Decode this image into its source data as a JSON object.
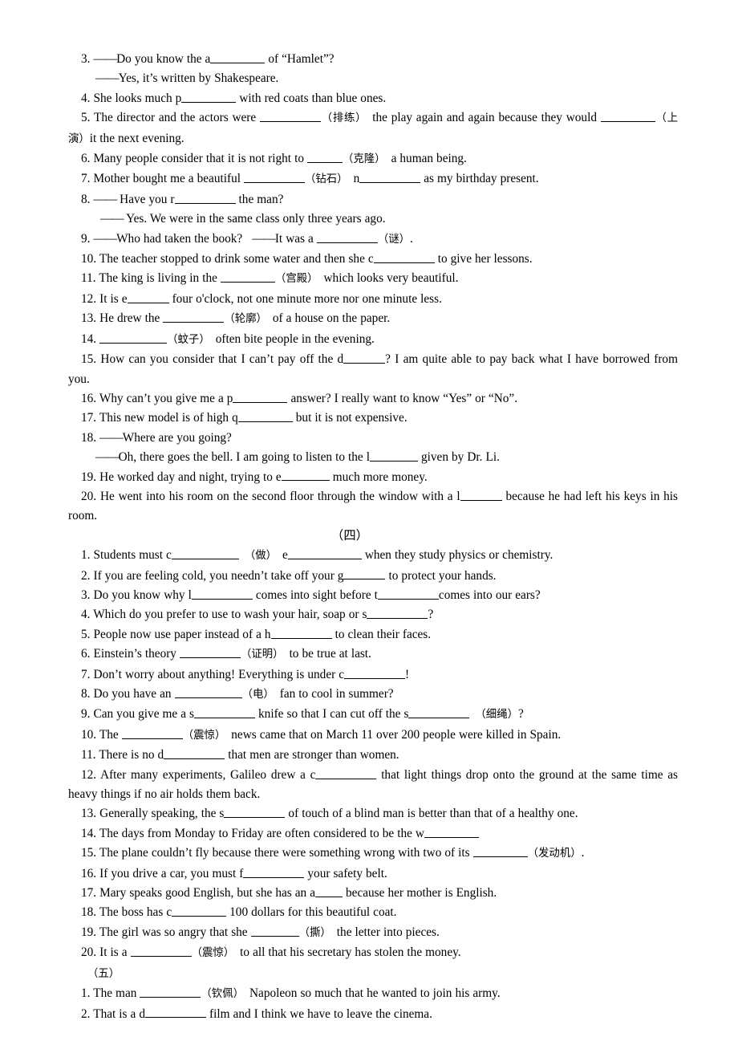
{
  "document": {
    "type": "english-vocabulary-fill-in-the-blank-worksheet",
    "sections": [
      {
        "id": "section-three-continued",
        "header": null,
        "items": [
          {
            "num": "3.",
            "text_parts": [
              "——Do you know the a",
              "BLANK_8",
              " of “Hamlet”?"
            ]
          },
          {
            "num": "",
            "text_parts": [
              "——Yes, it’s written by Shakespeare."
            ]
          },
          {
            "num": "4.",
            "text_parts": [
              "She looks much p",
              "BLANK_8",
              " with red coats than blue ones."
            ]
          },
          {
            "num": "5.",
            "text_parts": [
              "The director and the actors were ",
              "BLANK_9",
              " （排练） the play again and again because they would ",
              "BLANK_8",
              " （上演） it the next evening."
            ]
          },
          {
            "num": "6.",
            "text_parts": [
              "Many people consider that it is not right to ",
              "BLANK_5",
              " （克隆） a human being."
            ]
          },
          {
            "num": "7.",
            "text_parts": [
              "Mother bought me a beautiful ",
              "BLANK_9",
              " （钻石） n",
              "BLANK_9",
              " as my birthday present."
            ]
          },
          {
            "num": "8.",
            "text_parts": [
              "—— Have you r",
              "BLANK_9",
              " the man?"
            ]
          },
          {
            "num": "",
            "text_parts": [
              "—— Yes. We were in the same class only three years ago."
            ]
          },
          {
            "num": "9.",
            "text_parts": [
              "——Who had taken the book?  ——It was a ",
              "BLANK_9",
              " （谜）."
            ]
          },
          {
            "num": "10.",
            "text_parts": [
              "The teacher stopped to drink some water and then she c",
              "BLANK_9",
              " to give her lessons."
            ]
          },
          {
            "num": "11.",
            "text_parts": [
              "The king is living in the ",
              "BLANK_8",
              " （宫殿） which looks very beautiful."
            ]
          },
          {
            "num": "12.",
            "text_parts": [
              "It is e",
              "BLANK_6",
              " four o'clock, not one minute more nor one minute less."
            ]
          },
          {
            "num": "13.",
            "text_parts": [
              "He drew the ",
              "BLANK_9",
              " （轮廓） of a house on the paper."
            ]
          },
          {
            "num": "14.",
            "text_parts": [
              "",
              "BLANK_10",
              " （蚊子） often bite people in the evening."
            ]
          },
          {
            "num": "15.",
            "text_parts": [
              "How can you consider that I can’t pay off the d",
              "BLANK_6",
              "? I am quite able to pay back what I have borrowed from you."
            ]
          },
          {
            "num": "16.",
            "text_parts": [
              "Why can’t you give me a p",
              "BLANK_8",
              " answer? I really want to know “Yes” or “No”."
            ]
          },
          {
            "num": "17.",
            "text_parts": [
              "This new model is of high q",
              "BLANK_8",
              " but it is not expensive."
            ]
          },
          {
            "num": "18.",
            "text_parts": [
              "——Where are you going?"
            ]
          },
          {
            "num": "",
            "text_parts": [
              "——Oh, there goes the bell. I am going to listen to the l",
              "BLANK_7",
              " given by Dr. Li."
            ]
          },
          {
            "num": "19.",
            "text_parts": [
              "He worked day and night, trying to e",
              "BLANK_7",
              " much more money."
            ]
          },
          {
            "num": "20.",
            "text_parts": [
              "He went into his room on the second floor through the window with a l",
              "BLANK_6",
              " because he had left his keys in his room."
            ]
          }
        ]
      },
      {
        "id": "section-four",
        "header": "（四）",
        "items": [
          {
            "num": "1.",
            "text_parts": [
              "Students must c",
              "BLANK_10",
              " （做） e",
              "BLANK_12",
              " when they study physics or chemistry."
            ]
          },
          {
            "num": "2.",
            "text_parts": [
              "If you are feeling cold, you needn’t take off your g",
              "BLANK_6",
              " to protect your hands."
            ]
          },
          {
            "num": "3.",
            "text_parts": [
              "Do you know why l",
              "BLANK_9",
              " comes into sight before t",
              "BLANK_9",
              " comes into our ears?"
            ]
          },
          {
            "num": "4.",
            "text_parts": [
              "Which do you prefer to use to wash your hair, soap or s",
              "BLANK_9",
              "?"
            ]
          },
          {
            "num": "5.",
            "text_parts": [
              "People now use paper instead of a h",
              "BLANK_9",
              " to clean their faces."
            ]
          },
          {
            "num": "6.",
            "text_parts": [
              "Einstein’s theory ",
              "BLANK_9",
              " （证明） to be true at last."
            ]
          },
          {
            "num": "7.",
            "text_parts": [
              "Don’t worry about anything! Everything is under c",
              "BLANK_9",
              "!"
            ]
          },
          {
            "num": "8.",
            "text_parts": [
              "Do you have an ",
              "BLANK_10",
              " （电） fan to cool in summer?"
            ]
          },
          {
            "num": "9.",
            "text_parts": [
              "Can you give me a s",
              "BLANK_9",
              " knife so that I can cut off the s",
              "BLANK_9",
              " （细绳）?"
            ]
          },
          {
            "num": "10.",
            "text_parts": [
              "The ",
              "BLANK_9",
              " （震惊） news came that on March 11 over 200 people were killed in Spain."
            ]
          },
          {
            "num": "11.",
            "text_parts": [
              "There is no d",
              "BLANK_9",
              " that men are stronger than women."
            ]
          },
          {
            "num": "12.",
            "text_parts": [
              "After many experiments, Galileo drew a c",
              "BLANK_9",
              " that light things drop onto the ground at the same time as heavy things if no air holds them back."
            ]
          },
          {
            "num": "13.",
            "text_parts": [
              "Generally speaking, the s",
              "BLANK_9",
              " of touch of a blind man is better than that of a healthy one."
            ]
          },
          {
            "num": "14.",
            "text_parts": [
              "The days from Monday to Friday are often considered to be the w",
              "BLANK_8",
              ""
            ]
          },
          {
            "num": "15.",
            "text_parts": [
              "The plane couldn’t fly because there were something wrong with two of its ",
              "BLANK_8",
              " （发动机）."
            ]
          },
          {
            "num": "16.",
            "text_parts": [
              "If you drive a car, you must f",
              "BLANK_9",
              " your safety belt."
            ]
          },
          {
            "num": "17.",
            "text_parts": [
              "Mary speaks good English, but she has an a",
              "BLANK_4",
              " because her mother is English."
            ]
          },
          {
            "num": "18.",
            "text_parts": [
              "The boss has c",
              "BLANK_8",
              " 100 dollars for this beautiful coat."
            ]
          },
          {
            "num": "19.",
            "text_parts": [
              "The girl was so angry that she ",
              "BLANK_7",
              " （撕） the letter into pieces."
            ]
          },
          {
            "num": "20.",
            "text_parts": [
              "It is a ",
              "BLANK_9",
              " （震惊） to all that his secretary has stolen the money."
            ]
          }
        ]
      },
      {
        "id": "section-five",
        "header": "（五）",
        "items": [
          {
            "num": "1.",
            "text_parts": [
              "The man ",
              "BLANK_9",
              " （钦佩） Napoleon so much that he wanted to join his army."
            ]
          },
          {
            "num": "2.",
            "text_parts": [
              "That is a d",
              "BLANK_9",
              " film and I think we have to leave the cinema."
            ]
          }
        ]
      }
    ]
  },
  "lines": {
    "q3a_num": "3.",
    "q3a_dash": "——",
    "q3a_t1": "Do you know the a",
    "q3a_t2": "of “Hamlet”?",
    "q3b_dash": "——",
    "q3b_t1": "Yes, it’s written by Shakespeare.",
    "q4_num": "4.",
    "q4_t1": "She looks much p",
    "q4_t2": "with red coats than blue ones.",
    "q5_num": "5.",
    "q5_t1": "The director and the actors were",
    "q5_cn1": "（排练）",
    "q5_t2": "the play again and again because they would",
    "q5_cn2": "（上演）",
    "q5_t3": "it the next evening.",
    "q6_num": "6.",
    "q6_t1": "Many people consider that it is not right to",
    "q6_cn1": "（克隆）",
    "q6_t2": "a human being.",
    "q7_num": "7.",
    "q7_t1": "Mother bought me a beautiful",
    "q7_cn1": "（钻石）",
    "q7_t2": "n",
    "q7_t3": "as my birthday present.",
    "q8a_num": "8.",
    "q8a_dash": "——",
    "q8a_t1": "Have you r",
    "q8a_t2": "the man?",
    "q8b_dash": "——",
    "q8b_t1": "Yes. We were in the same class only three years ago.",
    "q9_num": "9.",
    "q9_dash1": "——",
    "q9_t1": "Who had taken the book?",
    "q9_dash2": "——",
    "q9_t2": "It was a",
    "q9_cn1": "（谜）",
    "q9_t3": ".",
    "q10_num": "10.",
    "q10_t1": "The teacher stopped to drink some water and then she c",
    "q10_t2": "to give her lessons.",
    "q11_num": "11.",
    "q11_t1": "The king is living in the",
    "q11_cn1": "（宫殿）",
    "q11_t2": "which looks very beautiful.",
    "q12_num": "12.",
    "q12_t1": "It is e",
    "q12_t2": "four o'clock, not one minute more nor one minute less.",
    "q13_num": "13.",
    "q13_t1": "He drew the",
    "q13_cn1": "（轮廓）",
    "q13_t2": "of a house on the paper.",
    "q14_num": "14.",
    "q14_cn1": "（蚊子）",
    "q14_t2": "often bite people in the evening.",
    "q15_num": "15.",
    "q15_t1": "How can you consider that I can’t pay off the d",
    "q15_t2": "? I am quite able to pay back what I have borrowed from you.",
    "q16_num": "16.",
    "q16_t1": "Why can’t you give me a p",
    "q16_t2": "answer? I really want to know “Yes” or “No”.",
    "q17_num": "17.",
    "q17_t1": "This new model is of high q",
    "q17_t2": "but it is not expensive.",
    "q18a_num": "18.",
    "q18a_dash": "——",
    "q18a_t1": "Where are you going?",
    "q18b_dash": "——",
    "q18b_t1": "Oh, there goes the bell. I am going to listen to the l",
    "q18b_t2": "given by Dr. Li.",
    "q19_num": "19.",
    "q19_t1": "He worked day and night, trying to e",
    "q19_t2": "much more money.",
    "q20_num": "20.",
    "q20_t1": "He went into his room on the second floor through the window with a l",
    "q20_t2": "because he had left his keys in his room.",
    "s4_header": "（四）",
    "f1_num": "1.",
    "f1_t1": "Students must c",
    "f1_cn1": "（做）",
    "f1_t2": "e",
    "f1_t3": "when they study physics or chemistry.",
    "f2_num": "2.",
    "f2_t1": "If you are feeling cold, you needn’t take off your g",
    "f2_t2": "to protect your hands.",
    "f3_num": "3.",
    "f3_t1": "Do you know why l",
    "f3_t2": "comes into sight before t",
    "f3_t3": "comes into our ears?",
    "f4_num": "4.",
    "f4_t1": "Which do you prefer to use to wash your hair, soap or s",
    "f4_t2": "?",
    "f5_num": "5.",
    "f5_t1": "People now use paper instead of a h",
    "f5_t2": "to clean their faces.",
    "f6_num": "6.",
    "f6_t1": "Einstein’s theory",
    "f6_cn1": "（证明）",
    "f6_t2": "to be true at last.",
    "f7_num": "7.",
    "f7_t1": "Don’t worry about anything! Everything is under c",
    "f7_t2": "!",
    "f8_num": "8.",
    "f8_t1": "Do you have an",
    "f8_cn1": "（电）",
    "f8_t2": "fan to cool in summer?",
    "f9_num": "9.",
    "f9_t1": "Can you give me a s",
    "f9_t2": "knife so that I can cut off the s",
    "f9_cn1": "（细绳）",
    "f9_t3": "?",
    "f10_num": "10.",
    "f10_t1": "The",
    "f10_cn1": "（震惊）",
    "f10_t2": "news came that on March 11 over 200 people were killed in Spain.",
    "f11_num": "11.",
    "f11_t1": "There is no d",
    "f11_t2": "that men are stronger than women.",
    "f12_num": "12.",
    "f12_t1": "After many experiments, Galileo drew a c",
    "f12_t2": "that light things drop onto the ground at the same time as heavy things if no air holds them back.",
    "f13_num": "13.",
    "f13_t1": "Generally speaking, the s",
    "f13_t2": "of touch of a blind man is better than that of a healthy one.",
    "f14_num": "14.",
    "f14_t1": "The days from Monday to Friday are often considered to be the w",
    "f15_num": "15.",
    "f15_t1": "The plane couldn’t fly because there were something wrong with two of its",
    "f15_cn1": "（发动机）",
    "f15_t2": ".",
    "f16_num": "16.",
    "f16_t1": "If you drive a car, you must f",
    "f16_t2": "your safety belt.",
    "f17_num": "17.",
    "f17_t1": "Mary speaks good English, but she has an a",
    "f17_t2": "because her mother is English.",
    "f18_num": "18.",
    "f18_t1": "The boss has c",
    "f18_t2": "100 dollars for this beautiful coat.",
    "f19_num": "19.",
    "f19_t1": "The girl was so angry that she",
    "f19_cn1": "（撕）",
    "f19_t2": "the letter into pieces.",
    "f20_num": "20.",
    "f20_t1": "It is a",
    "f20_cn1": "（震惊）",
    "f20_t2": "to all that his secretary has stolen the money.",
    "s5_header": "（五）",
    "v1_num": "1.",
    "v1_t1": "The man",
    "v1_cn1": "（钦佩）",
    "v1_t2": "Napoleon so much that he wanted to join his army.",
    "v2_num": "2.",
    "v2_t1": "That is a d",
    "v2_t2": "film and I think we have to leave the cinema."
  }
}
